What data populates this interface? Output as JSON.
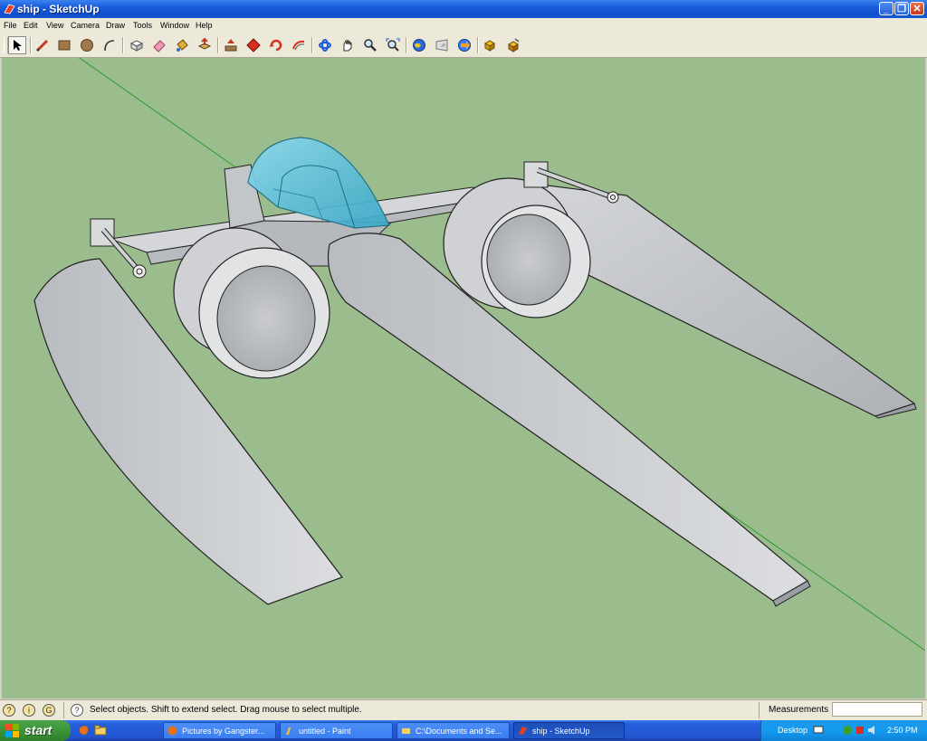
{
  "window": {
    "title": "ship - SketchUp",
    "minimize_glyph": "_",
    "restore_glyph": "❐",
    "close_glyph": "✕"
  },
  "menu": [
    "File",
    "Edit",
    "View",
    "Camera",
    "Draw",
    "Tools",
    "Window",
    "Help"
  ],
  "toolbar": {
    "tools": [
      "select-icon",
      "pencil-icon",
      "rectangle-icon",
      "circle-icon",
      "arc-icon",
      "make-component-icon",
      "eraser-icon",
      "paint-bucket-icon",
      "push-pull-icon",
      "move-icon",
      "rotate-icon",
      "offset-icon",
      "orbit-icon",
      "pan-icon",
      "zoom-icon",
      "zoom-extents-icon",
      "get-models-icon",
      "share-model-icon",
      "google-earth-icon",
      "components-icon",
      "materials-icon"
    ]
  },
  "statusbar": {
    "message": "Select objects. Shift to extend select. Drag mouse to select multiple.",
    "help_glyph": "?",
    "measurements_label": "Measurements",
    "measurements_value": ""
  },
  "taskbar": {
    "start_label": "start",
    "tasks": [
      {
        "label": "Pictures by Gangster..."
      },
      {
        "label": "untitled - Paint"
      },
      {
        "label": "C:\\Documents and Se..."
      },
      {
        "label": "ship - SketchUp"
      }
    ],
    "desktop_label": "Desktop",
    "clock": "2:50 PM"
  },
  "colors": {
    "viewport_bg": "#9bbd8d",
    "titlebar": "#1a5cd8",
    "model_gray": "#c6c8cb",
    "canopy": "#5fc3db",
    "axis_green": "#2f9a2f"
  }
}
